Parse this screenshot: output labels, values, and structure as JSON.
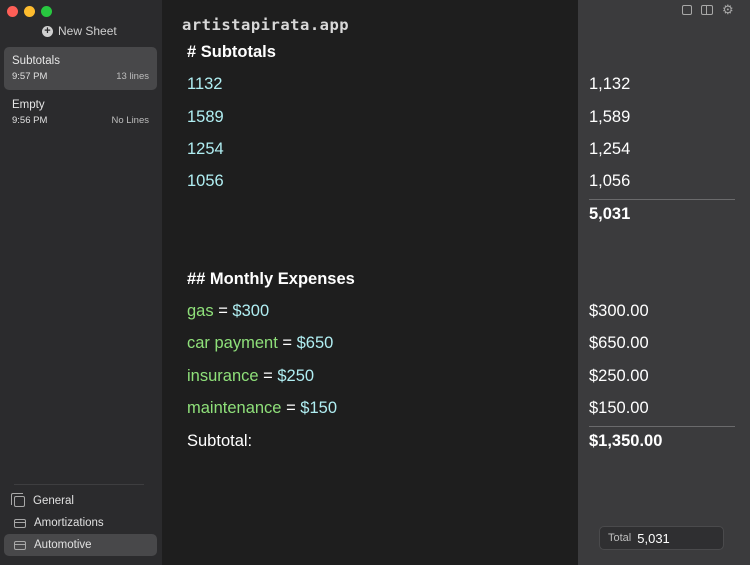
{
  "sidebar": {
    "new_sheet_label": "New Sheet",
    "sheets": [
      {
        "name": "Subtotals",
        "time": "9:57 PM",
        "lines": "13 lines"
      },
      {
        "name": "Empty",
        "time": "9:56 PM",
        "lines": "No Lines"
      }
    ],
    "groups": [
      {
        "label": "General"
      },
      {
        "label": "Amortizations"
      },
      {
        "label": "Automotive"
      }
    ]
  },
  "watermark": "artistapirata.app",
  "editor": {
    "heading1": "# Subtotals",
    "numbers": [
      "1132",
      "1589",
      "1254",
      "1056"
    ],
    "heading2": "## Monthly Expenses",
    "expenses": [
      {
        "var": "gas",
        "op": " = ",
        "value": "$300"
      },
      {
        "var": "car payment",
        "op": " = ",
        "value": "$650"
      },
      {
        "var": "insurance",
        "op": " = ",
        "value": "$250"
      },
      {
        "var": "maintenance",
        "op": " = ",
        "value": "$150"
      }
    ],
    "subtotal_label": "Subtotal:"
  },
  "results": {
    "numbers": [
      "1,132",
      "1,589",
      "1,254",
      "1,056"
    ],
    "subtotal1": "5,031",
    "expenses": [
      "$300.00",
      "$650.00",
      "$250.00",
      "$150.00"
    ],
    "subtotal2": "$1,350.00"
  },
  "footer": {
    "total_label": "Total",
    "total_value": "5,031"
  }
}
